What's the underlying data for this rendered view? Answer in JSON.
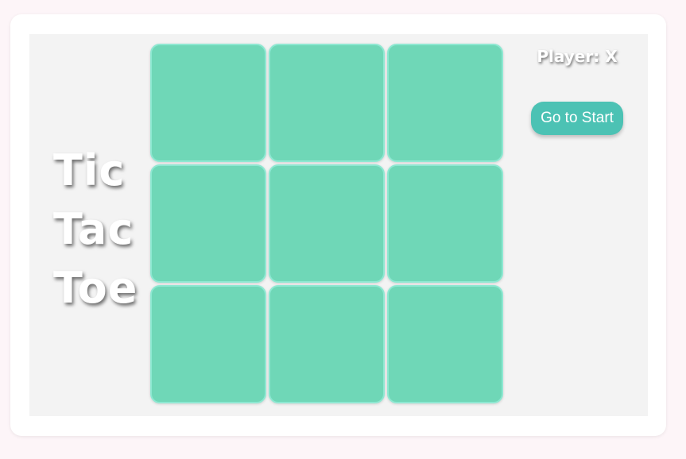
{
  "title": {
    "line1": "Tic",
    "line2": "Tac",
    "line3": "Toe"
  },
  "board": {
    "cells": [
      "",
      "",
      "",
      "",
      "",
      "",
      "",
      "",
      ""
    ]
  },
  "status": {
    "player_text": "Player: X"
  },
  "controls": {
    "start_label": "Go to Start"
  },
  "colors": {
    "page_background": "#fdf5f8",
    "panel_background": "#f3f3f3",
    "cell_fill": "#6fd7b7",
    "cell_border": "#8ee8d2",
    "button_fill": "#4cc2b4",
    "text": "#ffffff"
  }
}
